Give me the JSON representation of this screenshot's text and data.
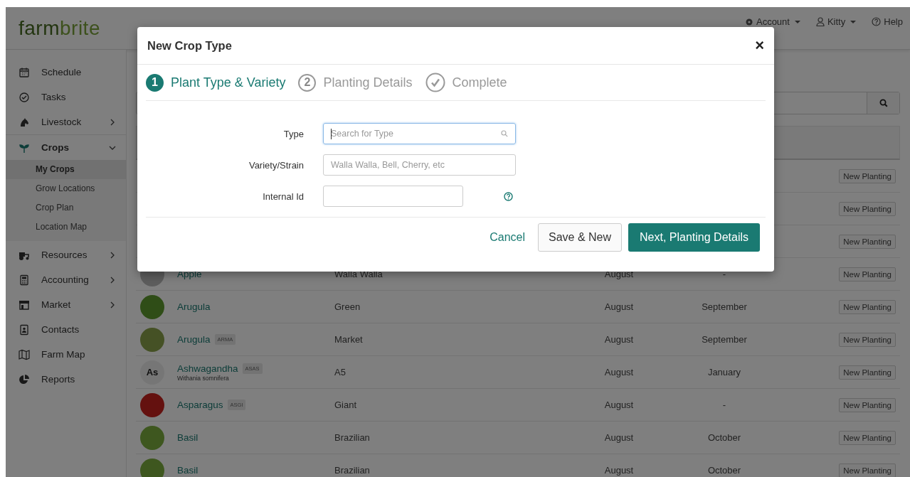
{
  "header": {
    "logo": {
      "part1": "farm",
      "part2": "brite"
    },
    "nav": [
      {
        "label": "Account",
        "kind": "dropdown"
      },
      {
        "label": "Kitty",
        "kind": "dropdown"
      },
      {
        "label": "Help",
        "kind": "link"
      }
    ]
  },
  "sidebar": {
    "items": [
      {
        "label": "Schedule",
        "expandable": false
      },
      {
        "label": "Tasks",
        "expandable": false
      },
      {
        "label": "Livestock",
        "expandable": true,
        "expanded": false
      },
      {
        "label": "Crops",
        "expandable": true,
        "expanded": true,
        "children": [
          {
            "label": "My Crops",
            "selected": true
          },
          {
            "label": "Grow Locations",
            "selected": false
          },
          {
            "label": "Crop Plan",
            "selected": false
          },
          {
            "label": "Location Map",
            "selected": false
          }
        ]
      },
      {
        "label": "Resources",
        "expandable": true,
        "expanded": false
      },
      {
        "label": "Accounting",
        "expandable": true,
        "expanded": false
      },
      {
        "label": "Market",
        "expandable": true,
        "expanded": false
      },
      {
        "label": "Contacts",
        "expandable": false
      },
      {
        "label": "Farm Map",
        "expandable": false
      },
      {
        "label": "Reports",
        "expandable": false
      }
    ]
  },
  "table": {
    "rows": [
      {
        "action": "New Planting"
      },
      {
        "action": "New Planting"
      },
      {
        "action": "New Planting"
      },
      {
        "avatar": {
          "kind": "image"
        },
        "name": "Apple",
        "variety": "Walla Walla",
        "column_4": "August",
        "column_5": "-",
        "action": "New Planting"
      },
      {
        "avatar": {
          "kind": "image"
        },
        "name": "Arugula",
        "variety": "Green",
        "column_4": "August",
        "column_5": "September",
        "action": "New Planting"
      },
      {
        "avatar": {
          "kind": "image"
        },
        "name": "Arugula",
        "tag": "ARMA",
        "variety": "Market",
        "column_4": "August",
        "column_5": "September",
        "action": "New Planting"
      },
      {
        "avatar": {
          "kind": "initials",
          "text": "As"
        },
        "name": "Ashwagandha",
        "tag": "ASAS",
        "subtitle": "Withania somnifera",
        "variety": "A5",
        "column_4": "August",
        "column_5": "January",
        "action": "New Planting"
      },
      {
        "avatar": {
          "kind": "image"
        },
        "name": "Asparagus",
        "tag": "ASGI",
        "variety": "Giant",
        "column_4": "August",
        "column_5": "-",
        "action": "New Planting"
      },
      {
        "avatar": {
          "kind": "image"
        },
        "name": "Basil",
        "variety": "Brazilian",
        "column_4": "August",
        "column_5": "October",
        "action": "New Planting"
      },
      {
        "avatar": {
          "kind": "image"
        },
        "name": "Basil",
        "variety": "Brazilian",
        "column_4": "August",
        "column_5": "October",
        "action": "New Planting"
      }
    ]
  },
  "modal": {
    "title": "New Crop Type",
    "close": "×",
    "steps": [
      {
        "kind": "number",
        "number": "1",
        "label": "Plant Type & Variety",
        "selected": true
      },
      {
        "kind": "number",
        "number": "2",
        "label": "Planting Details",
        "selected": false
      },
      {
        "kind": "check",
        "label": "Complete",
        "selected": false
      }
    ],
    "fields": [
      {
        "label": "Type",
        "placeholder": "Search for Type",
        "kind": "search",
        "focused": true
      },
      {
        "label": "Variety/Strain",
        "placeholder": "Walla Walla, Bell, Cherry, etc",
        "kind": "text",
        "focused": false
      },
      {
        "label": "Internal Id",
        "kind": "short",
        "focused": false,
        "help": true
      }
    ],
    "buttons": [
      {
        "label": "Cancel",
        "kind": "link"
      },
      {
        "label": "Save & New",
        "kind": "default"
      },
      {
        "label": "Next, Planting Details",
        "kind": "primary"
      }
    ]
  }
}
